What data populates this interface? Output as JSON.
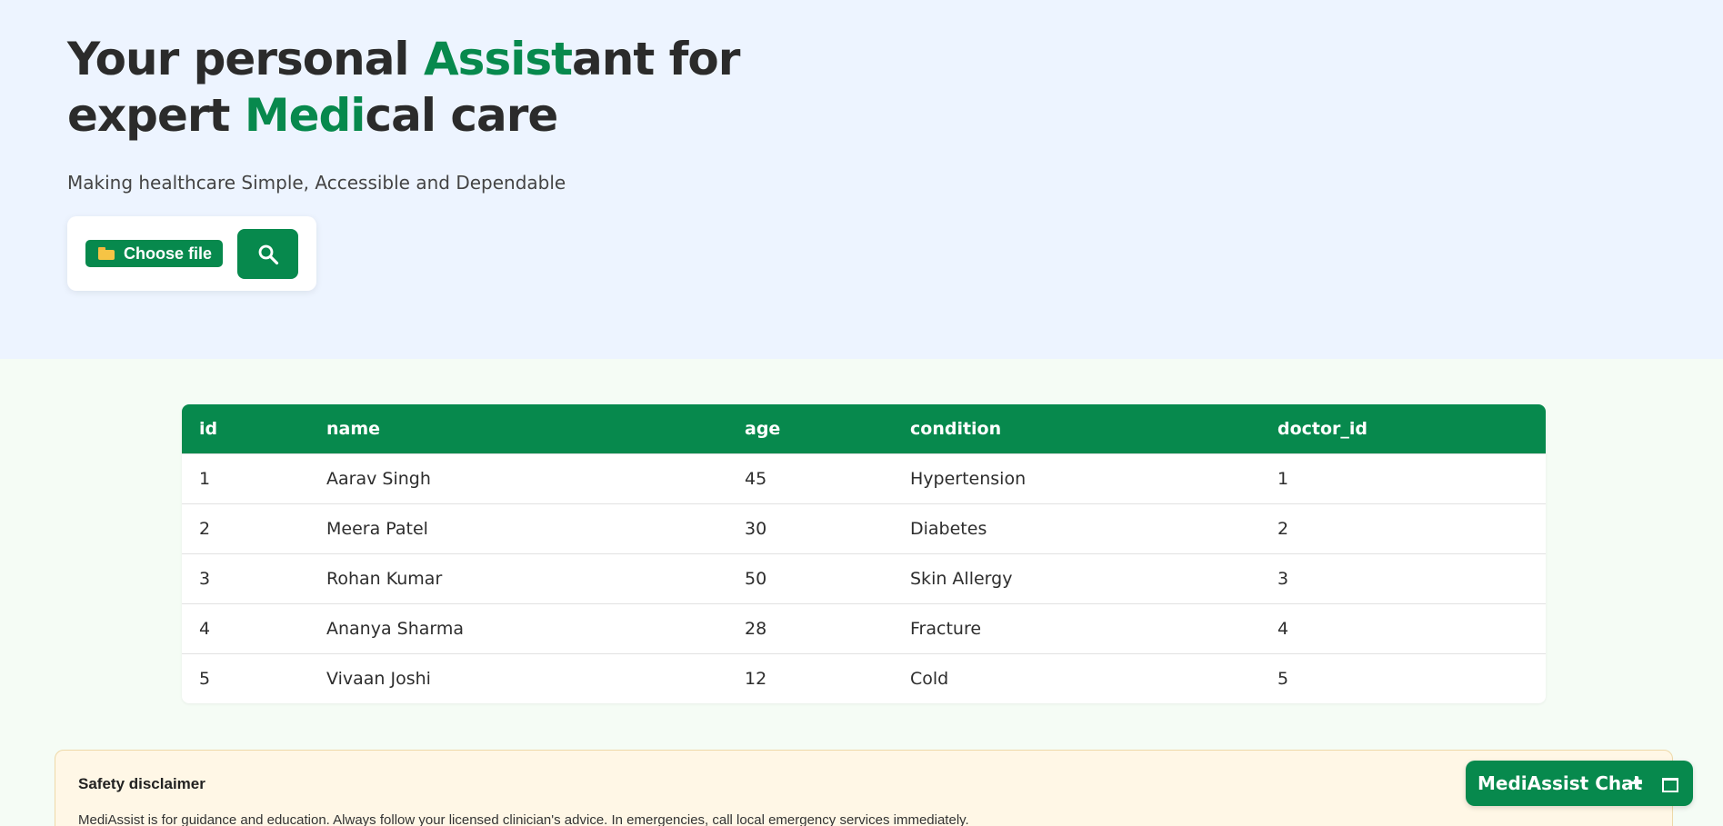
{
  "hero": {
    "title_line1_a": "Your personal ",
    "title_line1_hl": "Assist",
    "title_line1_b": "ant for",
    "title_line2_a": "expert ",
    "title_line2_hl": "Medi",
    "title_line2_b": "cal care",
    "subtitle": "Making healthcare Simple, Accessible and Dependable",
    "choose_file_label": "Choose file",
    "choose_file_icon": "folder-icon",
    "search_icon": "search-icon"
  },
  "table": {
    "headers": [
      "id",
      "name",
      "age",
      "condition",
      "doctor_id"
    ],
    "rows": [
      [
        "1",
        "Aarav Singh",
        "45",
        "Hypertension",
        "1"
      ],
      [
        "2",
        "Meera Patel",
        "30",
        "Diabetes",
        "2"
      ],
      [
        "3",
        "Rohan Kumar",
        "50",
        "Skin Allergy",
        "3"
      ],
      [
        "4",
        "Ananya Sharma",
        "28",
        "Fracture",
        "4"
      ],
      [
        "5",
        "Vivaan Joshi",
        "12",
        "Cold",
        "5"
      ]
    ]
  },
  "disclaimer": {
    "title": "Safety disclaimer",
    "text": "MediAssist is for guidance and education. Always follow your licensed clinician's advice. In emergencies, call local emergency services immediately."
  },
  "chat": {
    "label": "MediAssist Chat",
    "plus_icon": "plus-icon",
    "window_icon": "window-icon"
  },
  "colors": {
    "brand_green": "#07894d",
    "hero_bg": "#edf4ff",
    "page_bg": "#f5fcf5",
    "disclaimer_bg": "#fff7e6"
  }
}
